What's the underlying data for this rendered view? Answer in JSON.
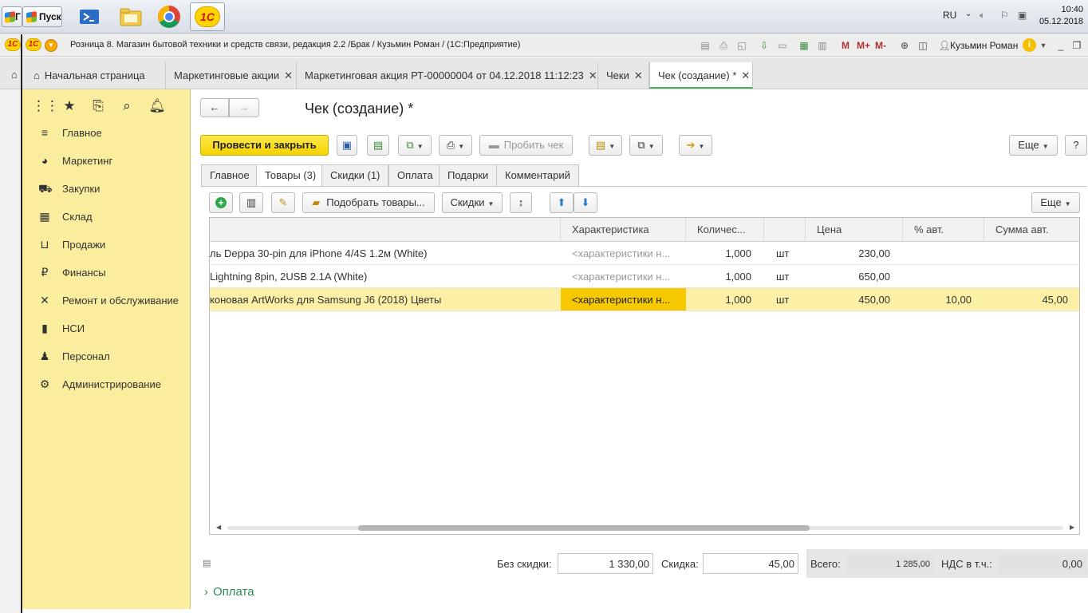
{
  "taskbar": {
    "start_left_label": "Г",
    "start_label": "Пуск",
    "lang": "RU",
    "time": "10:40",
    "date": "05.12.2018"
  },
  "titlebar": {
    "title": "Розница 8. Магазин бытовой техники и средств связи, редакция 2.2 /Брак / Кузьмин Роман /  (1С:Предприятие)",
    "m_label": "M",
    "mplus_label": "M+",
    "mminus_label": "M-",
    "user": "Кузьмин Роман"
  },
  "tabs": [
    {
      "label": "Начальная страница"
    },
    {
      "label": "Маркетинговые акции"
    },
    {
      "label": "Маркетинговая акция РТ-00000004 от 04.12.2018 11:12:23"
    },
    {
      "label": "Чеки"
    },
    {
      "label": "Чек (создание) *"
    }
  ],
  "sidebar": {
    "items": [
      {
        "label": "Главное",
        "icon": "menu-icon"
      },
      {
        "label": "Маркетинг",
        "icon": "pie-chart-icon"
      },
      {
        "label": "Закупки",
        "icon": "cart-icon"
      },
      {
        "label": "Склад",
        "icon": "warehouse-icon"
      },
      {
        "label": "Продажи",
        "icon": "basket-icon"
      },
      {
        "label": "Финансы",
        "icon": "ruble-icon"
      },
      {
        "label": "Ремонт и обслуживание",
        "icon": "tools-icon"
      },
      {
        "label": "НСИ",
        "icon": "books-icon"
      },
      {
        "label": "Персонал",
        "icon": "person-icon"
      },
      {
        "label": "Администрирование",
        "icon": "gear-icon"
      }
    ]
  },
  "form": {
    "title": "Чек (создание) *",
    "post_close_label": "Провести и закрыть",
    "print_check_label": "Пробить чек",
    "more_label": "Еще",
    "help_label": "?",
    "tabs": [
      "Главное",
      "Товары (3)",
      "Скидки (1)",
      "Оплата",
      "Подарки",
      "Комментарий"
    ],
    "pick_goods_label": "Подобрать товары...",
    "discounts_label": "Скидки",
    "more2_label": "Еще"
  },
  "table": {
    "columns": [
      "",
      "Характеристика",
      "Количес...",
      "",
      "Цена",
      "% авт.",
      "Сумма авт."
    ],
    "rows": [
      {
        "name": "ль Deppa 30-pin для iPhone 4/4S 1.2м (White)",
        "char": "<характеристики н...",
        "qty": "1,000",
        "unit": "шт",
        "price": "230,00",
        "pct": "",
        "sum": ""
      },
      {
        "name": "Lightning 8pin, 2USB 2.1A (White)",
        "char": "<характеристики н...",
        "qty": "1,000",
        "unit": "шт",
        "price": "650,00",
        "pct": "",
        "sum": ""
      },
      {
        "name": "коновая ArtWorks для Samsung J6 (2018) Цветы",
        "char": "<характеристики н...",
        "qty": "1,000",
        "unit": "шт",
        "price": "450,00",
        "pct": "10,00",
        "sum": "45,00"
      }
    ],
    "selected_row": 2
  },
  "footer": {
    "no_discount_label": "Без скидки:",
    "no_discount_value": "1 330,00",
    "discount_label": "Скидка:",
    "discount_value": "45,00",
    "total_label": "Всего:",
    "total_value": "1 285,00",
    "vat_label": "НДС в т.ч.:",
    "vat_value": "0,00",
    "payment_link": "Оплата"
  },
  "colors": {
    "accent_yellow": "#f6d200",
    "sidebar_bg": "#fbed9e",
    "selected_row": "#fbf0a5",
    "current_cell": "#f5c800",
    "link_green": "#2e8b57"
  }
}
